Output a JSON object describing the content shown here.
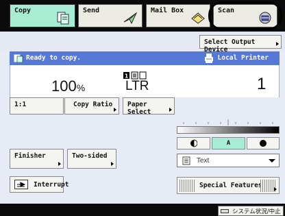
{
  "tabs": [
    {
      "label": "Copy",
      "icon": "copy-icon",
      "active": true
    },
    {
      "label": "Send",
      "icon": "send-icon",
      "active": false
    },
    {
      "label": "Mail Box",
      "icon": "mailbox-icon",
      "active": false
    },
    {
      "label": "Scan",
      "icon": "scan-icon",
      "active": false
    }
  ],
  "output_device_button": "Select Output Device",
  "status": {
    "message": "Ready to copy.",
    "printer": "Local Printer"
  },
  "copy_settings": {
    "ratio": "100",
    "ratio_unit": "%",
    "paper_size": "LTR",
    "copies": "1"
  },
  "buttons": {
    "one_to_one": "1:1",
    "copy_ratio": "Copy Ratio",
    "paper_select": "Paper Select",
    "finisher": "Finisher",
    "two_sided": "Two-sided",
    "interrupt": "Interrupt",
    "special_features": "Special Features"
  },
  "density": {
    "auto_label": "A",
    "light_icon": "light-icon",
    "dark_icon": "dark-icon"
  },
  "original_type": {
    "selected": "Text"
  },
  "system_button": "システム状況/中止",
  "colors": {
    "active_tab": "#a8ecd4",
    "status_bar": "#5678d6",
    "background": "#e6ebf6"
  }
}
